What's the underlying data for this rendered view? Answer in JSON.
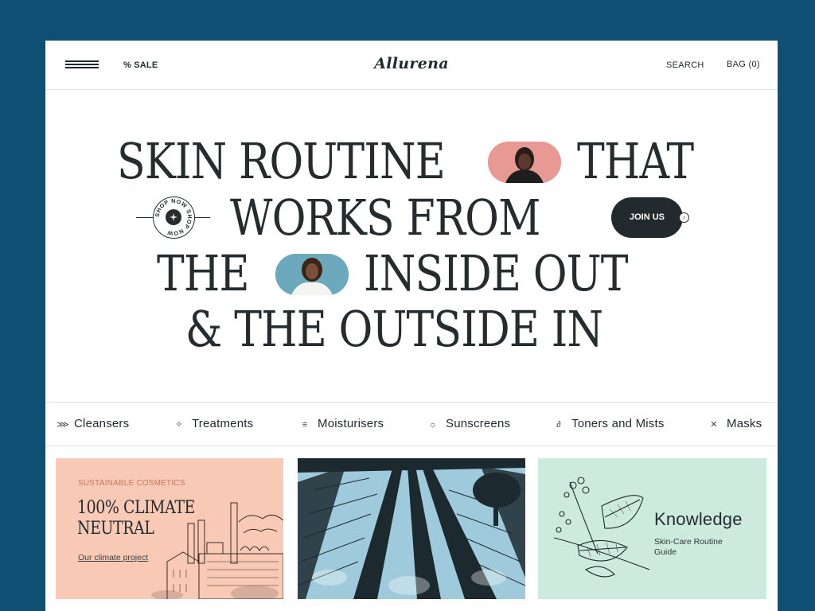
{
  "header": {
    "sale_label": "% SALE",
    "logo_text": "Allurena",
    "search_label": "SEARCH",
    "bag_label": "BAG (0)"
  },
  "hero": {
    "line1_a": "SKIN ROUTINE",
    "line1_b": "THAT",
    "line2": "WORKS FROM",
    "line3_a": "THE",
    "line3_b": "INSIDE OUT",
    "line4": "& THE OUTSIDE IN",
    "join_label": "JOIN US",
    "badge_text": "SHOP NOW SHOP NOW"
  },
  "categories": [
    {
      "label": "Cleansers",
      "icon": "cleansers-icon"
    },
    {
      "label": "Treatments",
      "icon": "treatments-icon"
    },
    {
      "label": "Moisturisers",
      "icon": "moisturisers-icon"
    },
    {
      "label": "Sunscreens",
      "icon": "sunscreens-icon"
    },
    {
      "label": "Toners and Mists",
      "icon": "toners-icon"
    },
    {
      "label": "Masks",
      "icon": "masks-icon"
    }
  ],
  "cards": {
    "climate": {
      "eyebrow": "SUSTAINABLE COSMETICS",
      "title_line1": "100% CLIMATE",
      "title_line2": "NEUTRAL",
      "link": "Our climate project"
    },
    "knowledge": {
      "title": "Knowledge",
      "subtitle": "Skin-Care Routine Guide"
    }
  },
  "colors": {
    "background": "#0f4f74",
    "ink": "#242c30",
    "card_peach": "#f8cab5",
    "card_blue": "#9fcadb",
    "card_mint": "#cdeadf",
    "pill_pink": "#e89994",
    "pill_blue": "#6da9bd",
    "eyebrow": "#c8755c"
  }
}
